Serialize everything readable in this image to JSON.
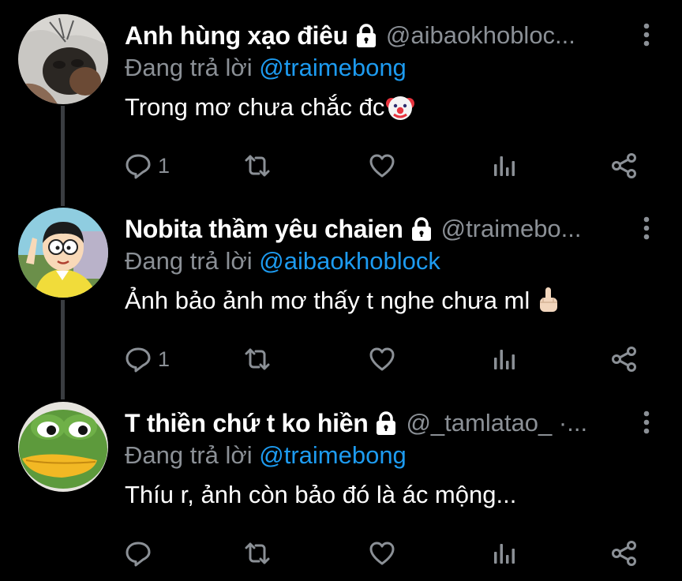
{
  "tweets": [
    {
      "display_name": "Anh hùng xạo điêu",
      "handle": "@aibaokhobloc...",
      "reply_prefix": "Đang trả lời ",
      "reply_to": "@traimebong",
      "text": "Trong mơ chưa chắc đc",
      "emoji": "clown-face-icon",
      "reply_count": "1"
    },
    {
      "display_name": "Nobita thầm yêu chaien",
      "handle": "@traimebo...",
      "reply_prefix": "Đang trả lời ",
      "reply_to": "@aibaokhoblock",
      "text": "Ảnh bảo ảnh mơ thấy t nghe chưa ml",
      "emoji": "middle-finger-icon",
      "reply_count": "1"
    },
    {
      "display_name": "T thiền chứ t ko hiền",
      "handle": "@_tamlatao_ ·...",
      "reply_prefix": "Đang trả lời ",
      "reply_to": "@traimebong",
      "text": "Thíu r, ảnh còn bảo đó là ác mộng...",
      "emoji": "",
      "reply_count": ""
    }
  ],
  "colors": {
    "background": "#000000",
    "text": "#ffffff",
    "muted": "#8b9096",
    "accent": "#1d9bf0",
    "thread_line": "#3a3d41"
  }
}
